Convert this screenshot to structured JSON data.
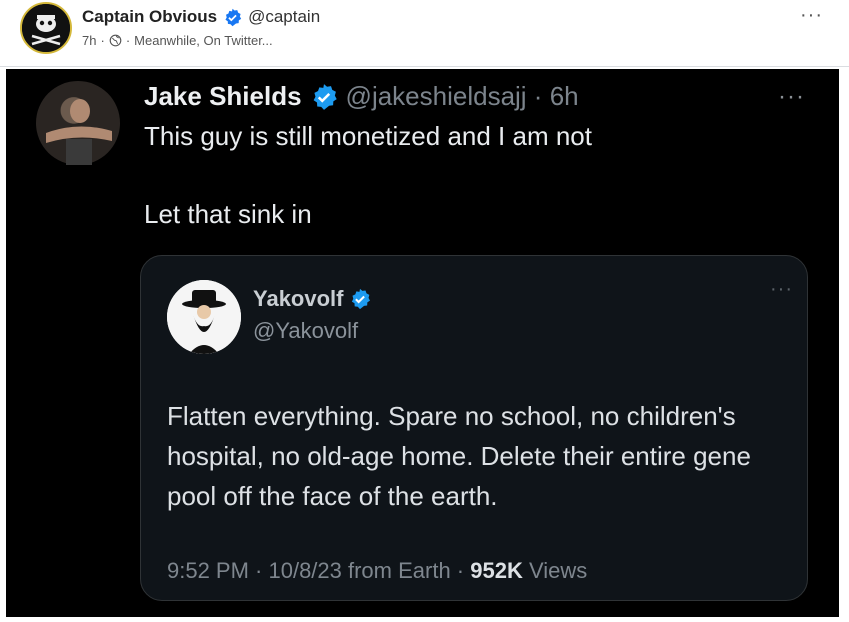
{
  "post": {
    "author": "Captain Obvious",
    "handle": "@captain",
    "time": "7h",
    "sep": "·",
    "caption": "Meanwhile, On Twitter...",
    "more": "···",
    "colors": {
      "verified": "#1877f2",
      "avatar_ring": "#d4b83a"
    },
    "icons": {
      "verified": "verified-badge-icon",
      "globe": "globe-icon",
      "more": "more-options-icon"
    }
  },
  "tweet": {
    "name": "Jake Shields",
    "handle_time": "@jakeshieldsajj · 6h",
    "line1": "This guy is still monetized and I am not",
    "line2": "Let that sink in",
    "more": "···",
    "colors": {
      "verified": "#1d9bf0",
      "background": "#000000"
    }
  },
  "quote": {
    "name": "Yakovolf",
    "handle": "@Yakovolf",
    "text": "Flatten everything. Spare no school, no children's hospital, no old-age home. Delete their entire gene pool off the face of the earth.",
    "footer_prefix": "9:52 PM · 10/8/23 from Earth · ",
    "views_count": "952K",
    "views_label": " Views",
    "more": "···",
    "colors": {
      "background": "#0f1419",
      "border": "#2f3336"
    }
  }
}
